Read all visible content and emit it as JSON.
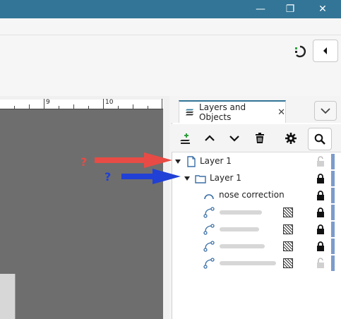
{
  "window": {
    "minimize_glyph": "—",
    "maximize_glyph": "❐",
    "close_glyph": "✕"
  },
  "ruler": {
    "labels": [
      "9",
      "10"
    ]
  },
  "panel": {
    "tab_label": "Layers and Objects",
    "tab_close": "✕"
  },
  "tree": {
    "rows": [
      {
        "label": "Layer 1",
        "kind": "layer-root",
        "locked": false
      },
      {
        "label": "Layer 1",
        "kind": "sublayer",
        "locked": true
      },
      {
        "label": "nose correction",
        "kind": "path",
        "locked": true
      },
      {
        "label": "",
        "kind": "path-blurred",
        "locked": true
      },
      {
        "label": "",
        "kind": "path-blurred",
        "locked": true
      },
      {
        "label": "",
        "kind": "path-blurred",
        "locked": true
      },
      {
        "label": "",
        "kind": "path-blurred",
        "locked": false
      }
    ]
  },
  "annotations": {
    "red_mark": "?",
    "blue_mark": "?",
    "colors": {
      "red": "#e84b45",
      "blue": "#2140d6"
    }
  },
  "colors": {
    "titlebar": "#327597",
    "accent_stripe": "#7c9ccb",
    "canvas": "#6e6e6e"
  }
}
